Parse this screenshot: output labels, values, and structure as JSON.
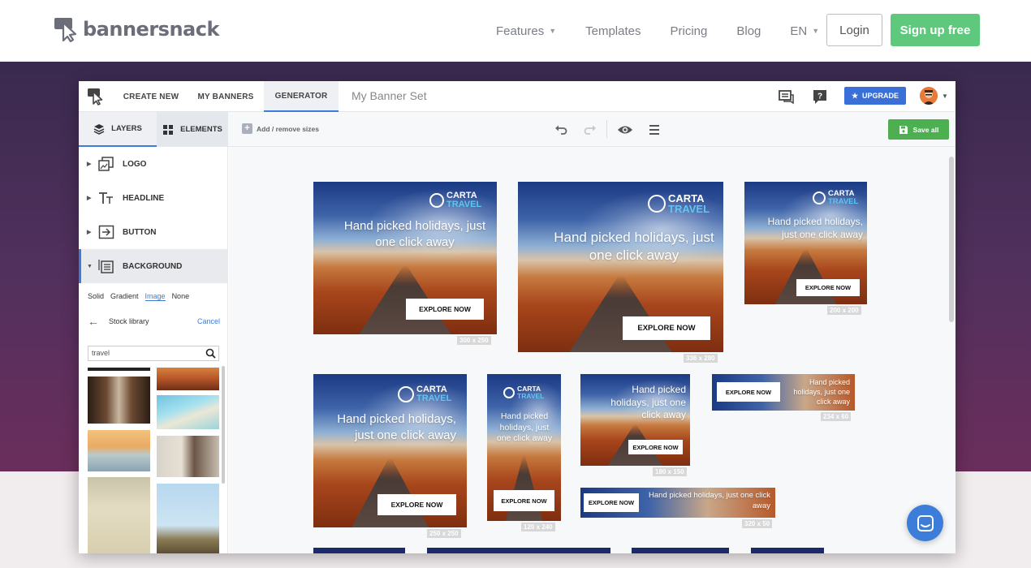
{
  "site": {
    "brand": "bannersnack",
    "nav": [
      {
        "label": "Features",
        "dropdown": true
      },
      {
        "label": "Templates",
        "dropdown": false
      },
      {
        "label": "Pricing",
        "dropdown": false
      },
      {
        "label": "Blog",
        "dropdown": false
      },
      {
        "label": "EN",
        "dropdown": true
      }
    ],
    "login": "Login",
    "signup": "Sign up free"
  },
  "app": {
    "tabs": [
      "CREATE NEW",
      "MY BANNERS",
      "GENERATOR"
    ],
    "active_tab": "GENERATOR",
    "banner_set_title": "My Banner Set",
    "upgrade": "UPGRADE"
  },
  "toolbar": {
    "panel_tabs": [
      "LAYERS",
      "ELEMENTS"
    ],
    "add_sizes": "Add / remove sizes",
    "save_all": "Save all"
  },
  "layers": [
    {
      "label": "LOGO",
      "icon": "logo-layer-icon",
      "expanded": false
    },
    {
      "label": "HEADLINE",
      "icon": "text-layer-icon",
      "expanded": false
    },
    {
      "label": "BUTTON",
      "icon": "button-layer-icon",
      "expanded": false
    },
    {
      "label": "BACKGROUND",
      "icon": "background-layer-icon",
      "expanded": true
    }
  ],
  "background": {
    "types": [
      "Solid",
      "Gradient",
      "Image",
      "None"
    ],
    "selected_type": "Image",
    "stock_label": "Stock library",
    "cancel": "Cancel",
    "search_value": "travel"
  },
  "banner_common": {
    "brand_top": "CARTA",
    "brand_bottom": "TRAVEL",
    "headline": "Hand picked holidays, just one click away",
    "cta": "EXPLORE NOW"
  },
  "banners": [
    {
      "size": "300 x 250"
    },
    {
      "size": "336 x 280"
    },
    {
      "size": "200 x 200"
    },
    {
      "size": "250 x 250"
    },
    {
      "size": "120 x 240"
    },
    {
      "size": "180 x 150"
    },
    {
      "size": "234 x 60"
    },
    {
      "size": "320 x 50"
    }
  ],
  "colors": {
    "accent": "#3b7dd8",
    "signup": "#5ec97d",
    "save": "#4caf50",
    "travel": "#5cc7f2"
  }
}
